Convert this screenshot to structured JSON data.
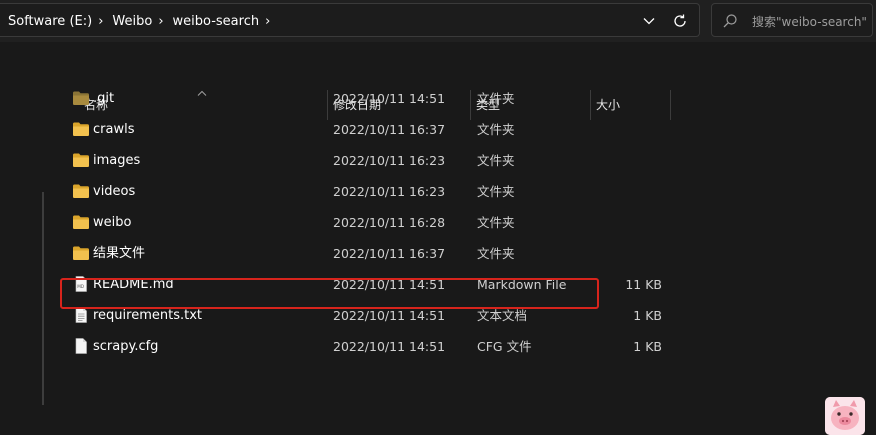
{
  "address_bar": {
    "breadcrumbs": [
      "Software (E:)",
      "Weibo",
      "weibo-search"
    ]
  },
  "search": {
    "placeholder": "搜索\"weibo-search\""
  },
  "columns": {
    "name": "名称",
    "modified": "修改日期",
    "type": "类型",
    "size": "大小"
  },
  "files": [
    {
      "name": ".git",
      "modified": "2022/10/11 14:51",
      "type": "文件夹",
      "size": "",
      "icon": "folder-icon"
    },
    {
      "name": "crawls",
      "modified": "2022/10/11 16:37",
      "type": "文件夹",
      "size": "",
      "icon": "folder-icon"
    },
    {
      "name": "images",
      "modified": "2022/10/11 16:23",
      "type": "文件夹",
      "size": "",
      "icon": "folder-icon"
    },
    {
      "name": "videos",
      "modified": "2022/10/11 16:23",
      "type": "文件夹",
      "size": "",
      "icon": "folder-icon"
    },
    {
      "name": "weibo",
      "modified": "2022/10/11 16:28",
      "type": "文件夹",
      "size": "",
      "icon": "folder-icon"
    },
    {
      "name": "结果文件",
      "modified": "2022/10/11 16:37",
      "type": "文件夹",
      "size": "",
      "icon": "folder-icon"
    },
    {
      "name": "README.md",
      "modified": "2022/10/11 14:51",
      "type": "Markdown File",
      "size": "11 KB",
      "icon": "markdown-file-icon"
    },
    {
      "name": "requirements.txt",
      "modified": "2022/10/11 14:51",
      "type": "文本文档",
      "size": "1 KB",
      "icon": "text-file-icon"
    },
    {
      "name": "scrapy.cfg",
      "modified": "2022/10/11 14:51",
      "type": "CFG 文件",
      "size": "1 KB",
      "icon": "file-icon"
    }
  ],
  "colors": {
    "background": "#191919",
    "folder": "#f2c14e",
    "highlight_box": "#d7241c"
  }
}
